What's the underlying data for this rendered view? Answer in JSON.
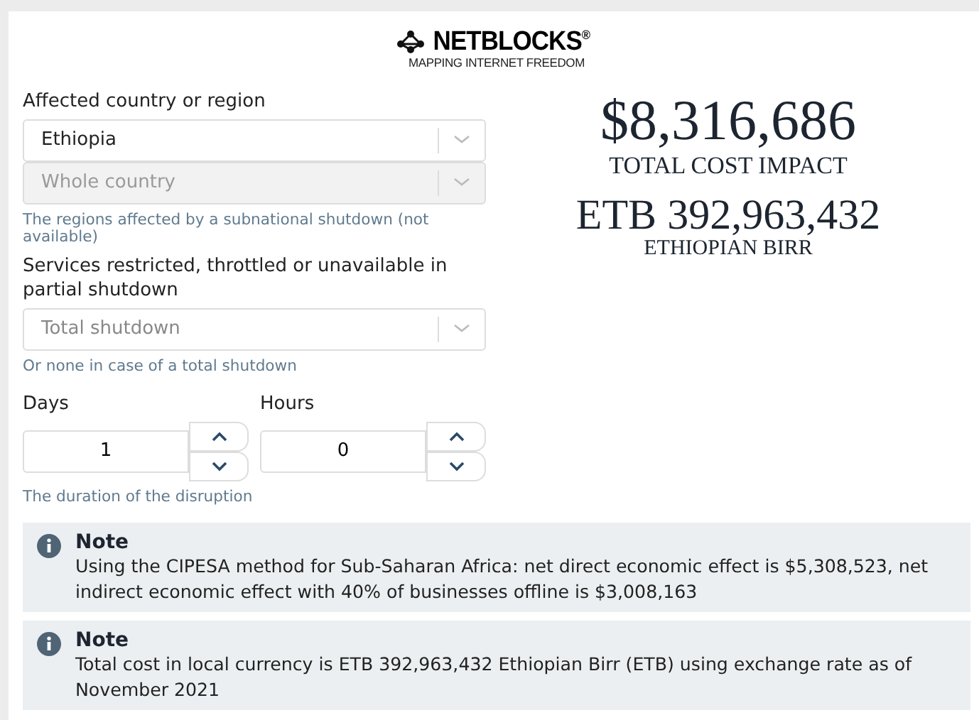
{
  "logo": {
    "name": "NETBLOCKS$^{®}$",
    "tagline": "MAPPING INTERNET FREEDOM"
  },
  "form": {
    "fields": [
      {
        "kind": "select",
        "label": "Affected country or region",
        "value": "Ethiopia",
        "disabled": false
      },
      {
        "kind": "select",
        "placeholder": "Whole country",
        "disabled": true,
        "help": "The regions affected by a subnational shutdown (not available)"
      },
      {
        "kind": "select",
        "label": "Services restricted, throttled or unavailable in partial shutdown",
        "placeholder": "Total shutdown",
        "disabled": false,
        "help": "Or none in case of a total shutdown"
      }
    ],
    "duration": {
      "spinners": [
        {
          "label": "Days",
          "value": "1"
        },
        {
          "label": "Hours",
          "value": "0"
        }
      ],
      "help": "The duration of the disruption"
    }
  },
  "results": [
    {
      "amount": "$8,316,686",
      "caption": "TOTAL COST IMPACT"
    },
    {
      "amount": "ETB 392,963,432",
      "caption": "ETHIOPIAN BIRR"
    }
  ],
  "notes": [
    {
      "title": "Note",
      "text": "Using the CIPESA method for Sub-Saharan Africa: net direct economic effect is $5,308,523, net indirect economic effect with 40% of businesses offline is $3,008,163"
    },
    {
      "title": "Note",
      "text": "Total cost in local currency is ETB 392,963,432 Ethiopian Birr (ETB) using exchange rate as of November 2021"
    }
  ]
}
